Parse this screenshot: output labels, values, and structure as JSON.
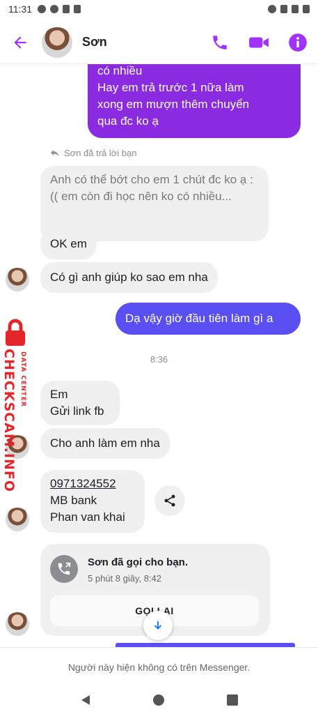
{
  "status_bar": {
    "time": "11:31"
  },
  "header": {
    "contact_name": "Sơn"
  },
  "messages": {
    "out_top_lines": [
      "có nhiều",
      "Hay em trả trước 1 nữa làm",
      "xong em mượn thêm chuyển",
      "qua đc ko ạ"
    ],
    "reply_note": "Sơn đã trả lời bạn",
    "quoted_reply": "Anh có thể bớt cho em 1 chút đc ko ạ :(( em còn đi học nên ko có nhiều...",
    "in_ok": "OK em",
    "in_help": "Có gì anh giúp ko sao em nha",
    "out_question": "Dạ vậy giờ đầu tiên làm gì a",
    "time_separator": "8:36",
    "in_em_line1": "Em",
    "in_em_line2": "Gửi link fb",
    "in_lam": "Cho anh làm em nha",
    "bank_phone": "0971324552",
    "bank_name": "MB bank",
    "bank_holder": "Phan van khai"
  },
  "call_card": {
    "title": "Sơn đã gọi cho bạn.",
    "subtitle": "5 phút 8 giây, 8:42",
    "button_label": "GỌI LẠI"
  },
  "footer": {
    "note": "Người này hiện không có trên Messenger."
  },
  "watermark": {
    "main": "CHECKSCAM.INFO",
    "sub": "DATA CENTER"
  },
  "colors": {
    "accent": "#8a2be2",
    "outgoing_blue": "#5a4ff3",
    "icon_purple": "#a033ff"
  }
}
